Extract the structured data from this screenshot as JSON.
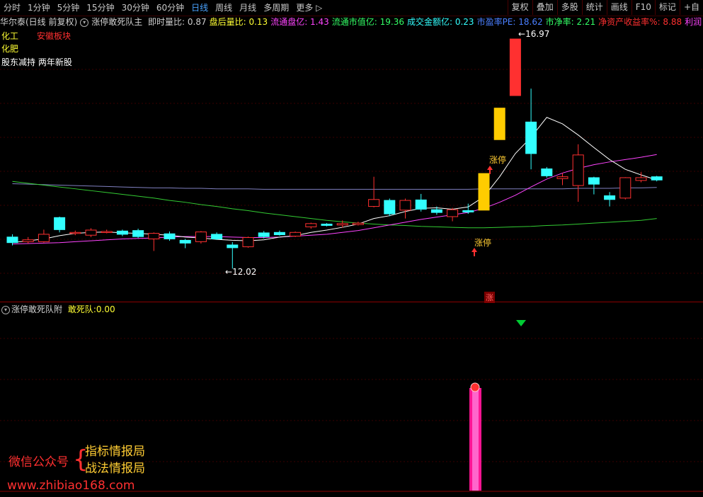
{
  "toolbar": {
    "periods": [
      "分时",
      "1分钟",
      "5分钟",
      "15分钟",
      "30分钟",
      "60分钟",
      "日线",
      "周线",
      "月线",
      "多周期",
      "更多"
    ],
    "active_period": "日线",
    "right_buttons": [
      "复权",
      "叠加",
      "多股",
      "统计",
      "画线",
      "F10",
      "标记",
      "+自"
    ]
  },
  "info": {
    "stock": "华尔泰(日线 前复权)",
    "indicator": "涨停敢死队主",
    "items": [
      {
        "label": "即时量比:",
        "value": "0.87",
        "color": "#d0d0d0"
      },
      {
        "label": "盘后量比:",
        "value": "0.13",
        "color": "#ffff33"
      },
      {
        "label": "流通盘亿:",
        "value": "1.43",
        "color": "#ff44ff"
      },
      {
        "label": "流通市值亿:",
        "value": "19.36",
        "color": "#33ff66"
      },
      {
        "label": "成交金额亿:",
        "value": "0.23",
        "color": "#33ffff"
      },
      {
        "label": "市盈率PE:",
        "value": "18.62",
        "color": "#4a7fff"
      },
      {
        "label": "市净率:",
        "value": "2.21",
        "color": "#33ff66"
      },
      {
        "label": "净资产收益率%:",
        "value": "8.88",
        "color": "#ff3030"
      },
      {
        "label": "利润",
        "value": "",
        "color": "#ff44ff"
      }
    ]
  },
  "tags": {
    "industry": "化工",
    "sector": "安徽板块",
    "concept": "化肥",
    "notes": "股东减持 两年新股"
  },
  "annotations": {
    "high": "16.97",
    "low": "12.02",
    "limit_up_1": "涨停",
    "limit_up_2": "涨停",
    "zhang_mark": "涨"
  },
  "sub_panel": {
    "indicator": "涨停敢死队附",
    "label": "敢死队:",
    "value": "0.00"
  },
  "watermark": {
    "left": "微信公众号",
    "line1": "指标情报局",
    "line2": "战法情报局",
    "url": "www.zhibiao168.com"
  },
  "colors": {
    "up": "#ff3030",
    "down": "#33ffff",
    "limit_up_fill": "#ffcc00",
    "ma5": "#ffffff",
    "ma10": "#ff44ff",
    "ma60": "#33cc33",
    "ma120": "#8080c0",
    "signal_bar": "#ff1493"
  },
  "chart_data": {
    "type": "candlestick",
    "price_range": [
      11.4,
      17.2
    ],
    "candles": [
      {
        "o": 12.7,
        "c": 12.58,
        "h": 12.76,
        "l": 12.52,
        "color": "down"
      },
      {
        "o": 12.6,
        "c": 12.64,
        "h": 12.7,
        "l": 12.56,
        "color": "up"
      },
      {
        "o": 12.6,
        "c": 12.76,
        "h": 12.86,
        "l": 12.58,
        "color": "up"
      },
      {
        "o": 13.12,
        "c": 12.86,
        "h": 13.14,
        "l": 12.8,
        "color": "down"
      },
      {
        "o": 12.78,
        "c": 12.8,
        "h": 12.84,
        "l": 12.74,
        "color": "up"
      },
      {
        "o": 12.74,
        "c": 12.85,
        "h": 12.89,
        "l": 12.7,
        "color": "up"
      },
      {
        "o": 12.8,
        "c": 12.82,
        "h": 12.86,
        "l": 12.78,
        "color": "up"
      },
      {
        "o": 12.83,
        "c": 12.76,
        "h": 12.86,
        "l": 12.72,
        "color": "down"
      },
      {
        "o": 12.84,
        "c": 12.71,
        "h": 12.88,
        "l": 12.68,
        "color": "down"
      },
      {
        "o": 12.66,
        "c": 12.78,
        "h": 12.8,
        "l": 12.4,
        "color": "up"
      },
      {
        "o": 12.77,
        "c": 12.66,
        "h": 12.82,
        "l": 12.62,
        "color": "down"
      },
      {
        "o": 12.63,
        "c": 12.57,
        "h": 12.66,
        "l": 12.46,
        "color": "down"
      },
      {
        "o": 12.6,
        "c": 12.81,
        "h": 12.83,
        "l": 12.56,
        "color": "up"
      },
      {
        "o": 12.76,
        "c": 12.66,
        "h": 12.8,
        "l": 12.64,
        "color": "down"
      },
      {
        "o": 12.53,
        "c": 12.47,
        "h": 12.59,
        "l": 12.02,
        "color": "down"
      },
      {
        "o": 12.49,
        "c": 12.69,
        "h": 12.71,
        "l": 12.47,
        "color": "up"
      },
      {
        "o": 12.79,
        "c": 12.71,
        "h": 12.83,
        "l": 12.67,
        "color": "down"
      },
      {
        "o": 12.8,
        "c": 12.75,
        "h": 12.84,
        "l": 12.73,
        "color": "down"
      },
      {
        "o": 12.72,
        "c": 12.8,
        "h": 12.82,
        "l": 12.7,
        "color": "up"
      },
      {
        "o": 12.92,
        "c": 12.99,
        "h": 13.01,
        "l": 12.88,
        "color": "up"
      },
      {
        "o": 12.98,
        "c": 12.95,
        "h": 13.0,
        "l": 12.93,
        "color": "down"
      },
      {
        "o": 12.96,
        "c": 12.99,
        "h": 13.06,
        "l": 12.9,
        "color": "up"
      },
      {
        "o": 12.97,
        "c": 13.0,
        "h": 13.03,
        "l": 12.95,
        "color": "up"
      },
      {
        "o": 13.36,
        "c": 13.51,
        "h": 14.0,
        "l": 13.34,
        "color": "up"
      },
      {
        "o": 13.49,
        "c": 13.2,
        "h": 13.53,
        "l": 13.15,
        "color": "down"
      },
      {
        "o": 13.28,
        "c": 13.49,
        "h": 13.53,
        "l": 13.1,
        "color": "up"
      },
      {
        "o": 13.5,
        "c": 13.3,
        "h": 13.63,
        "l": 13.25,
        "color": "down"
      },
      {
        "o": 13.29,
        "c": 13.23,
        "h": 13.36,
        "l": 13.18,
        "color": "down"
      },
      {
        "o": 13.14,
        "c": 13.29,
        "h": 13.33,
        "l": 13.04,
        "color": "up"
      },
      {
        "o": 13.27,
        "c": 13.24,
        "h": 13.42,
        "l": 13.2,
        "color": "down"
      },
      {
        "o": 13.28,
        "c": 14.07,
        "h": 14.07,
        "l": 13.28,
        "color": "limit"
      },
      {
        "o": 14.8,
        "c": 15.48,
        "h": 15.48,
        "l": 14.8,
        "color": "limit"
      },
      {
        "o": 15.75,
        "c": 16.97,
        "h": 16.97,
        "l": 15.75,
        "color": "bigred"
      },
      {
        "o": 15.18,
        "c": 14.5,
        "h": 15.9,
        "l": 14.16,
        "color": "down"
      },
      {
        "o": 14.17,
        "c": 14.02,
        "h": 14.21,
        "l": 13.98,
        "color": "down"
      },
      {
        "o": 13.96,
        "c": 14.0,
        "h": 14.08,
        "l": 13.82,
        "color": "up"
      },
      {
        "o": 13.81,
        "c": 14.47,
        "h": 14.7,
        "l": 13.46,
        "color": "up"
      },
      {
        "o": 13.98,
        "c": 13.84,
        "h": 14.0,
        "l": 13.62,
        "color": "down"
      },
      {
        "o": 13.59,
        "c": 13.51,
        "h": 13.67,
        "l": 13.36,
        "color": "down"
      },
      {
        "o": 13.54,
        "c": 13.98,
        "h": 13.99,
        "l": 13.51,
        "color": "up"
      },
      {
        "o": 13.92,
        "c": 13.98,
        "h": 14.1,
        "l": 13.88,
        "color": "up"
      },
      {
        "o": 14.0,
        "c": 13.93,
        "h": 14.02,
        "l": 13.9,
        "color": "down"
      }
    ],
    "ma5": [
      12.58,
      12.62,
      12.66,
      12.73,
      12.78,
      12.8,
      12.81,
      12.79,
      12.78,
      12.76,
      12.74,
      12.7,
      12.68,
      12.65,
      12.63,
      12.62,
      12.64,
      12.7,
      12.73,
      12.8,
      12.85,
      12.91,
      12.98,
      13.1,
      13.16,
      13.25,
      13.32,
      13.33,
      13.3,
      13.35,
      13.57,
      14.0,
      14.5,
      14.85,
      15.28,
      15.14,
      14.9,
      14.63,
      14.37,
      14.16,
      14.04,
      13.93
    ],
    "ma10": [
      12.55,
      12.56,
      12.57,
      12.58,
      12.6,
      12.62,
      12.64,
      12.66,
      12.67,
      12.68,
      12.7,
      12.71,
      12.71,
      12.71,
      12.7,
      12.69,
      12.69,
      12.7,
      12.72,
      12.74,
      12.76,
      12.8,
      12.84,
      12.9,
      12.96,
      13.02,
      13.08,
      13.13,
      13.18,
      13.23,
      13.32,
      13.45,
      13.6,
      13.78,
      13.95,
      14.08,
      14.18,
      14.26,
      14.32,
      14.37,
      14.42,
      14.48
    ],
    "ma60": [
      13.9,
      13.86,
      13.82,
      13.78,
      13.74,
      13.7,
      13.66,
      13.62,
      13.58,
      13.54,
      13.49,
      13.45,
      13.4,
      13.36,
      13.31,
      13.27,
      13.22,
      13.18,
      13.14,
      13.1,
      13.06,
      13.03,
      13.0,
      12.98,
      12.96,
      12.95,
      12.93,
      12.92,
      12.91,
      12.9,
      12.9,
      12.91,
      12.92,
      12.93,
      12.95,
      12.96,
      12.98,
      13.0,
      13.02,
      13.04,
      13.06,
      13.1
    ],
    "ma120": [
      13.85,
      13.84,
      13.83,
      13.82,
      13.81,
      13.8,
      13.79,
      13.78,
      13.77,
      13.76,
      13.76,
      13.75,
      13.75,
      13.74,
      13.74,
      13.74,
      13.73,
      13.73,
      13.73,
      13.73,
      13.73,
      13.73,
      13.73,
      13.73,
      13.73,
      13.73,
      13.73,
      13.73,
      13.73,
      13.73,
      13.74,
      13.74,
      13.74,
      13.74,
      13.74,
      13.74,
      13.75,
      13.75,
      13.75,
      13.76,
      13.76,
      13.77
    ]
  }
}
